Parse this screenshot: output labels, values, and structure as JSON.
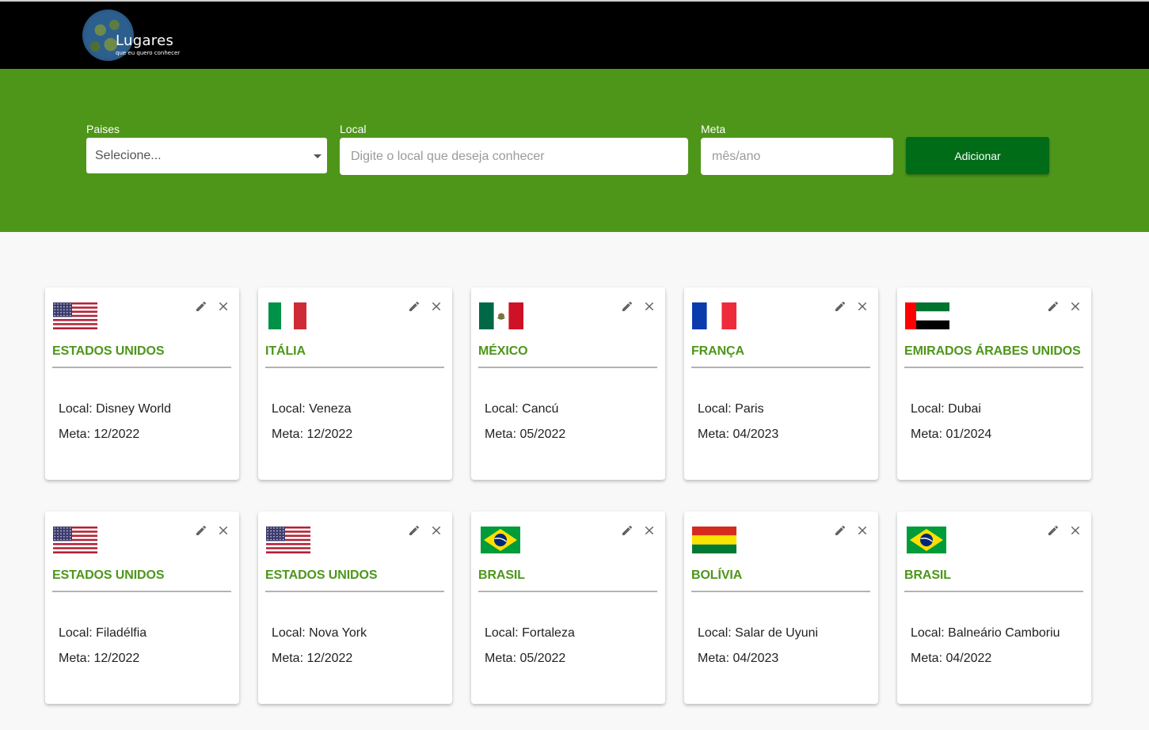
{
  "header": {
    "logo_title": "Lugares",
    "logo_subtitle": "que eu quero conhecer",
    "logo_icon": "globe-icon"
  },
  "form": {
    "country_label": "Paises",
    "country_value": "Selecione...",
    "local_label": "Local",
    "local_placeholder": "Digite o local que deseja conhecer",
    "meta_label": "Meta",
    "meta_placeholder": "mês/ano",
    "add_button": "Adicionar"
  },
  "colors": {
    "hero_green": "#4e961a",
    "button_green": "#006c17",
    "topbar": "#000000"
  },
  "cards": [
    {
      "country": "ESTADOS UNIDOS",
      "flag": "us-flag-icon",
      "local": "Local: Disney World",
      "meta": "Meta: 12/2022"
    },
    {
      "country": "ITÁLIA",
      "flag": "italy-flag-icon",
      "local": "Local: Veneza",
      "meta": "Meta: 12/2022"
    },
    {
      "country": "MÉXICO",
      "flag": "mexico-flag-icon",
      "local": "Local: Cancú",
      "meta": "Meta: 05/2022"
    },
    {
      "country": "FRANÇA",
      "flag": "france-flag-icon",
      "local": "Local: Paris",
      "meta": "Meta: 04/2023"
    },
    {
      "country": "EMIRADOS ÁRABES UNIDOS",
      "flag": "uae-flag-icon",
      "local": "Local: Dubai",
      "meta": "Meta: 01/2024"
    },
    {
      "country": "ESTADOS UNIDOS",
      "flag": "us-flag-icon",
      "local": "Local: Filadélfia",
      "meta": "Meta: 12/2022"
    },
    {
      "country": "ESTADOS UNIDOS",
      "flag": "us-flag-icon",
      "local": "Local: Nova York",
      "meta": "Meta: 12/2022"
    },
    {
      "country": "BRASIL",
      "flag": "brazil-flag-icon",
      "local": "Local: Fortaleza",
      "meta": "Meta: 05/2022"
    },
    {
      "country": "BOLÍVIA",
      "flag": "bolivia-flag-icon",
      "local": "Local: Salar de Uyuni",
      "meta": "Meta: 04/2023"
    },
    {
      "country": "BRASIL",
      "flag": "brazil-flag-icon",
      "local": "Local: Balneário Camboriu",
      "meta": "Meta: 04/2022"
    }
  ]
}
